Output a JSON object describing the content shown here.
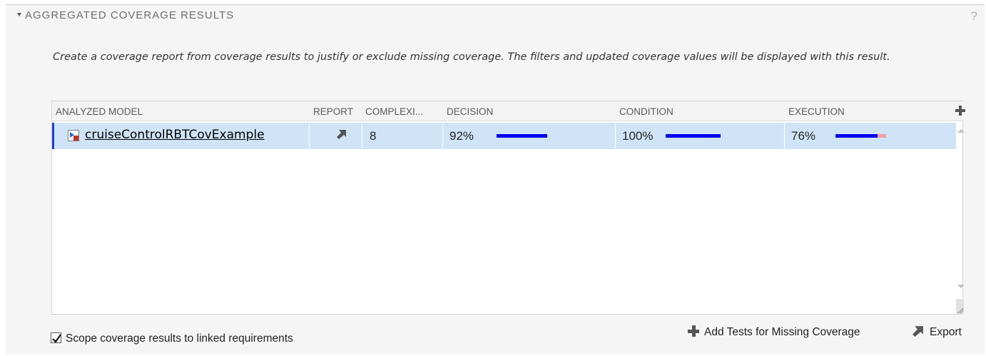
{
  "section": {
    "title": "AGGREGATED COVERAGE RESULTS",
    "help": "?",
    "description": "Create a coverage report from coverage results to justify or exclude missing coverage. The filters and updated coverage values will be displayed with this result."
  },
  "table": {
    "columns": [
      "ANALYZED MODEL",
      "REPORT",
      "COMPLEXI...",
      "DECISION",
      "CONDITION",
      "EXECUTION"
    ],
    "rows": [
      {
        "model": "cruiseControlRBTCovExample",
        "complexity": "8",
        "decision": "92%",
        "condition": "100%",
        "execution": "76%",
        "decision_covered": 0.92,
        "condition_covered": 1.0,
        "execution_covered": 0.76
      }
    ]
  },
  "footer": {
    "add_tests_label": "Add Tests for Missing Coverage",
    "export_label": "Export",
    "scope_checkbox_label": "Scope coverage results to linked requirements",
    "scope_checked": true
  },
  "colors": {
    "covered": "#0000ee",
    "missed": "#f4a0a0",
    "selected_row": "#cfe5f7",
    "row_marker": "#1a3fd6"
  },
  "icons": [
    "collapse-arrow-icon",
    "help-icon",
    "model-icon",
    "report-icon",
    "add-column-icon",
    "plus-icon",
    "export-icon",
    "checkmark-icon"
  ]
}
